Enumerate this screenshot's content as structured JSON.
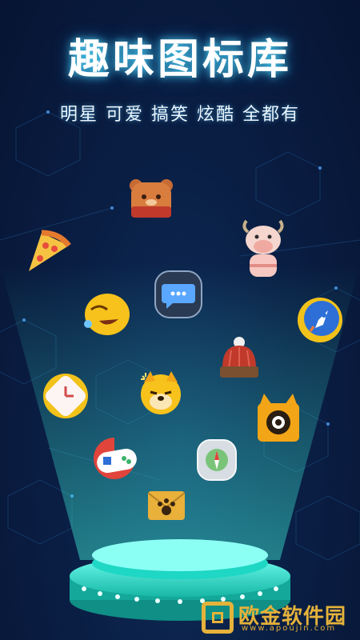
{
  "header": {
    "title": "趣味图标库",
    "subtitle": "明星 可爱 搞笑 炫酷 全都有"
  },
  "icons": [
    {
      "name": "bear-icon"
    },
    {
      "name": "pizza-icon"
    },
    {
      "name": "cow-icon"
    },
    {
      "name": "chat-bubble-icon"
    },
    {
      "name": "laughing-emoji-icon"
    },
    {
      "name": "rocket-icon"
    },
    {
      "name": "knit-hat-icon"
    },
    {
      "name": "clock-icon"
    },
    {
      "name": "doge-icon"
    },
    {
      "name": "camera-cat-icon"
    },
    {
      "name": "gamepad-icon"
    },
    {
      "name": "compass-icon"
    },
    {
      "name": "paw-envelope-icon"
    }
  ],
  "watermark": {
    "name": "欧金软件园",
    "url": "www.apoujin.com"
  },
  "colors": {
    "background": "#0a1f45",
    "glow": "#37f0d6",
    "accent": "#e5b23a"
  }
}
